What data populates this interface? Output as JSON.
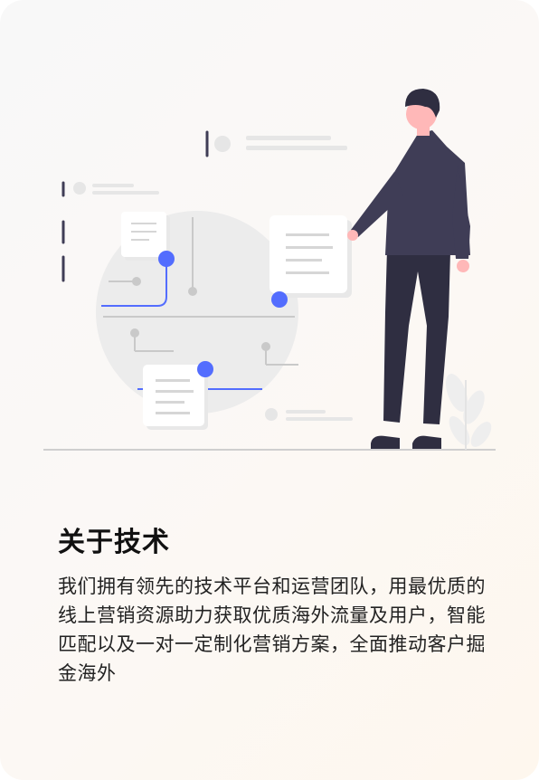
{
  "section": {
    "title": "关于技术",
    "description": "我们拥有领先的技术平台和运营团队，用最优质的线上营销资源助力获取优质海外流量及用户，智能匹配以及一对一定制化营销方案，全面推动客户掘金海外"
  },
  "colors": {
    "accent": "#536dfe",
    "figure_dark": "#2f2e41",
    "figure_shirt": "#3f3d56",
    "skin": "#ffb8b8",
    "card_bg": "#ffffff",
    "circle_bg": "#ececec"
  },
  "icons": [
    "person-illustration",
    "document-card-icon",
    "network-node-icon",
    "plant-icon"
  ]
}
